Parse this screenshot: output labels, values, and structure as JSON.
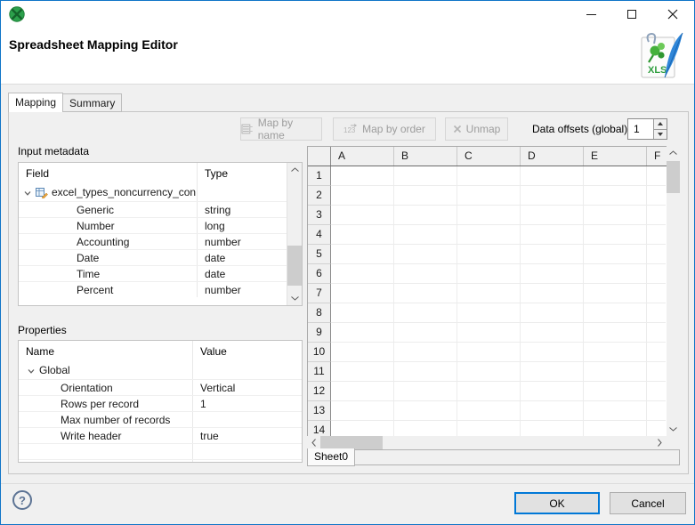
{
  "header": {
    "title": "Spreadsheet Mapping Editor",
    "xls_label": "XLS"
  },
  "tabs": {
    "mapping": "Mapping",
    "summary": "Summary"
  },
  "toolbar": {
    "map_by_name": "Map by name",
    "map_by_order": "Map by order",
    "unmap": "Unmap",
    "data_offsets_label": "Data offsets (global)",
    "data_offsets_value": "1"
  },
  "input_metadata": {
    "title": "Input metadata",
    "col_field": "Field",
    "col_type": "Type",
    "record_name": "excel_types_noncurrency_con",
    "rows": [
      {
        "field": "Generic",
        "type": "string"
      },
      {
        "field": "Number",
        "type": "long"
      },
      {
        "field": "Accounting",
        "type": "number"
      },
      {
        "field": "Date",
        "type": "date"
      },
      {
        "field": "Time",
        "type": "date"
      },
      {
        "field": "Percent",
        "type": "number"
      }
    ]
  },
  "properties": {
    "title": "Properties",
    "col_name": "Name",
    "col_value": "Value",
    "group": "Global",
    "rows": [
      {
        "name": "Orientation",
        "value": "Vertical"
      },
      {
        "name": "Rows per record",
        "value": "1"
      },
      {
        "name": "Max number of records",
        "value": ""
      },
      {
        "name": "Write header",
        "value": "true"
      }
    ],
    "empty_rows": 2
  },
  "spreadsheet": {
    "columns": [
      "A",
      "B",
      "C",
      "D",
      "E",
      "F"
    ],
    "rows": [
      "1",
      "2",
      "3",
      "4",
      "5",
      "6",
      "7",
      "8",
      "9",
      "10",
      "11",
      "12",
      "13",
      "14"
    ],
    "sheet_tab": "Sheet0"
  },
  "footer": {
    "ok": "OK",
    "cancel": "Cancel",
    "help": "?"
  },
  "colors": {
    "window_border": "#0f74c8",
    "accent": "#0078d7",
    "titlebar_bg": "#ffffff",
    "dialog_bg": "#f0f0f0",
    "disabled_text": "#9d9d9d",
    "logo_green": "#2ca04c",
    "feather_blue": "#2f86d8"
  }
}
